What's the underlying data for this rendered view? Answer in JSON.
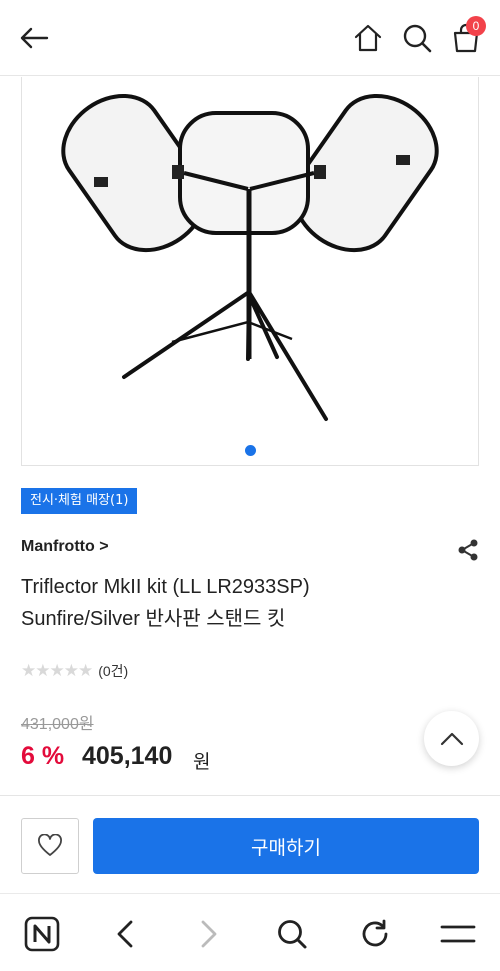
{
  "header": {
    "cart_count": "0"
  },
  "gallery": {
    "active_index": 1,
    "total": 1
  },
  "product": {
    "badge": "전시·체험 매장(1)",
    "brand": "Manfrotto >",
    "title_line1": "Triflector MkII kit (LL LR2933SP)",
    "title_line2": "Sunfire/Silver 반사판 스탠드 킷",
    "stars": "★★★★★",
    "rating_value": 0,
    "review_count": "(0건)",
    "original_price": "431,000원",
    "discount": "6 %",
    "price": "405,140",
    "currency": "원"
  },
  "actions": {
    "buy_label": "구매하기"
  },
  "colors": {
    "accent": "#1a73e8",
    "discount": "#e30b3b",
    "badge_red": "#f2424a"
  },
  "icons": [
    "back-arrow-icon",
    "home-icon",
    "search-icon",
    "shopping-bag-icon",
    "share-icon",
    "chevron-up-icon",
    "heart-icon",
    "naver-logo-icon",
    "nav-back-icon",
    "nav-forward-icon",
    "nav-search-icon",
    "refresh-icon",
    "menu-icon"
  ]
}
